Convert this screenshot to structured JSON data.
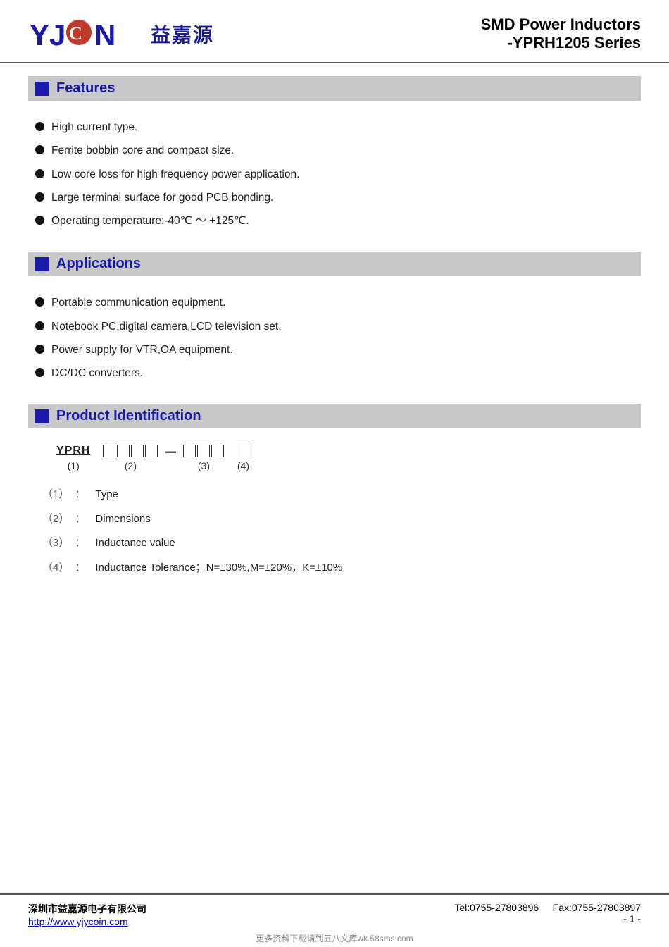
{
  "header": {
    "logo_text_cn": "益嘉源",
    "title_line1": "SMD Power Inductors",
    "title_line2": "-YPRH1205 Series"
  },
  "features": {
    "section_title": "Features",
    "items": [
      "High current type.",
      "Ferrite bobbin core and compact size.",
      "Low core loss for high frequency power application.",
      "Large terminal surface for good PCB bonding.",
      "Operating temperature:-40℃  ～ +125℃."
    ]
  },
  "applications": {
    "section_title": "Applications",
    "items": [
      "Portable communication equipment.",
      "Notebook PC,digital camera,LCD television set.",
      "Power supply for VTR,OA equipment.",
      "DC/DC converters."
    ]
  },
  "product_identification": {
    "section_title": "Product Identification",
    "diagram": {
      "part1_label": "YPRH",
      "part1_num": "(1)",
      "part2_boxes": 4,
      "part2_num": "(2)",
      "part3_boxes": 3,
      "part3_num": "(3)",
      "part4_boxes": 1,
      "part4_num": "(4)"
    },
    "descriptions": [
      {
        "num": "（1）",
        "colon": "：",
        "text": "Type"
      },
      {
        "num": "（2）",
        "colon": "：",
        "text": "Dimensions"
      },
      {
        "num": "（3）",
        "colon": "：",
        "text": "Inductance value"
      },
      {
        "num": "（4）",
        "colon": "：",
        "text": "Inductance Tolerance；N=±30%,M=±20%，K=±10%"
      }
    ]
  },
  "footer": {
    "company": "深圳市益嘉源电子有限公司",
    "tel": "Tel:0755-27803896",
    "fax": "Fax:0755-27803897",
    "website": "http://www.yjycoin.com",
    "page": "- 1 -",
    "watermark": "更多资料下载请到五八文库wk.58sms.com"
  }
}
